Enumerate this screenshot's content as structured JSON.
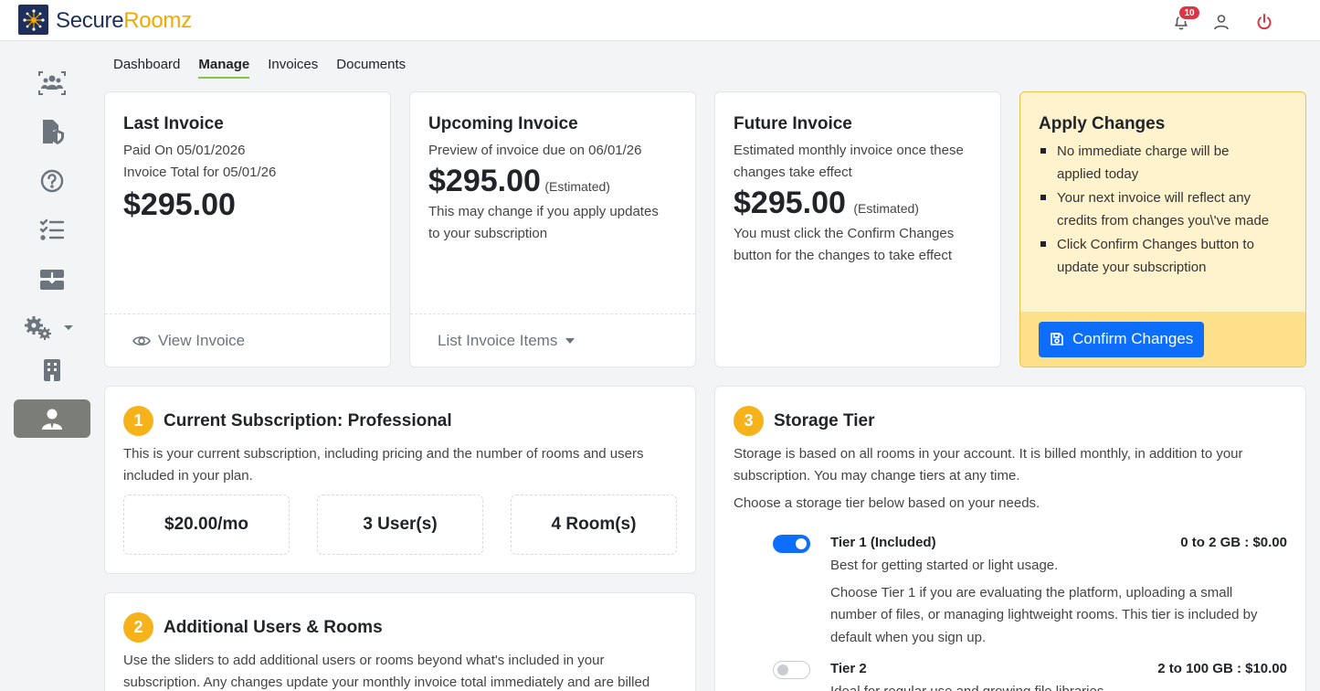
{
  "brand": {
    "name_part1": "Secure",
    "name_part2": "Roomz"
  },
  "header": {
    "notifications_count": "10"
  },
  "sidebar": {
    "items": [
      {
        "icon": "users-group-icon"
      },
      {
        "icon": "file-shield-icon"
      },
      {
        "icon": "help-circle-icon"
      },
      {
        "icon": "checklist-icon"
      },
      {
        "icon": "inbox-download-icon"
      },
      {
        "icon": "gears-icon"
      },
      {
        "icon": "building-icon"
      },
      {
        "icon": "account-user-icon",
        "active": true
      }
    ]
  },
  "tabs": [
    {
      "label": "Dashboard"
    },
    {
      "label": "Manage",
      "active": true
    },
    {
      "label": "Invoices"
    },
    {
      "label": "Documents"
    }
  ],
  "last_invoice": {
    "title": "Last Invoice",
    "paid_on": "Paid On 05/01/2026",
    "total_for": "Invoice Total for 05/01/26",
    "amount": "$295.00",
    "footer_label": "View Invoice"
  },
  "upcoming_invoice": {
    "title": "Upcoming Invoice",
    "preview": "Preview of invoice due on 06/01/26",
    "amount": "$295.00",
    "estimated": "(Estimated)",
    "note_line1": "This may change if you apply updates",
    "note_line2": "to your subscription",
    "footer_label": "List Invoice Items"
  },
  "future_invoice": {
    "title": "Future Invoice",
    "desc_line1": "Estimated monthly invoice once these",
    "desc_line2": "changes take effect",
    "amount": "$295.00",
    "estimated": "(Estimated)",
    "note_line1": "You must click the Confirm Changes",
    "note_line2": "button for the changes to take effect"
  },
  "apply_changes": {
    "title": "Apply Changes",
    "bullets": [
      {
        "line1": "No immediate charge will be",
        "line2": "applied today"
      },
      {
        "line1": "Your next invoice will reflect any",
        "line2": "credits from changes you\\'ve made"
      },
      {
        "line1": "Click Confirm Changes button to",
        "line2": "update your subscription"
      }
    ],
    "button_label": "Confirm Changes"
  },
  "current_subscription": {
    "step": "1",
    "title": "Current Subscription: Professional",
    "desc_line1": "This is your current subscription, including pricing and the number of rooms and users",
    "desc_line2": "included in your plan.",
    "price": "$20.00/mo",
    "users": "3 User(s)",
    "rooms": "4 Room(s)"
  },
  "additional": {
    "step": "2",
    "title": "Additional Users & Rooms",
    "desc_line1": "Use the sliders to add additional users or rooms beyond what's included in your",
    "desc_line2": "subscription. Any changes update your monthly invoice total immediately and are billed"
  },
  "storage": {
    "step": "3",
    "title": "Storage Tier",
    "desc_line1": "Storage is based on all rooms in your account. It is billed monthly, in addition to your",
    "desc_line2": "subscription. You may change tiers at any time.",
    "choose": "Choose a storage tier below based on your needs.",
    "tiers": [
      {
        "name": "Tier 1 (Included)",
        "price": "0 to 2 GB : $0.00",
        "subtitle": "Best for getting started or light usage.",
        "detail_line1": "Choose Tier 1 if you are evaluating the platform, uploading a small",
        "detail_line2": "number of files, or managing lightweight rooms. This tier is included by",
        "detail_line3": "default when you sign up.",
        "selected": true
      },
      {
        "name": "Tier 2",
        "price": "2 to 100 GB : $10.00",
        "subtitle": "Ideal for regular use and growing file libraries.",
        "selected": false
      }
    ]
  },
  "colors": {
    "accent": "#0d6efd",
    "brand_navy": "#1d2f5a",
    "brand_gold": "#f2a900",
    "step_badge": "#f6b21b",
    "apply_bg": "#fff3cd",
    "notification_badge": "#dc3545",
    "power_icon": "#dc3545"
  }
}
